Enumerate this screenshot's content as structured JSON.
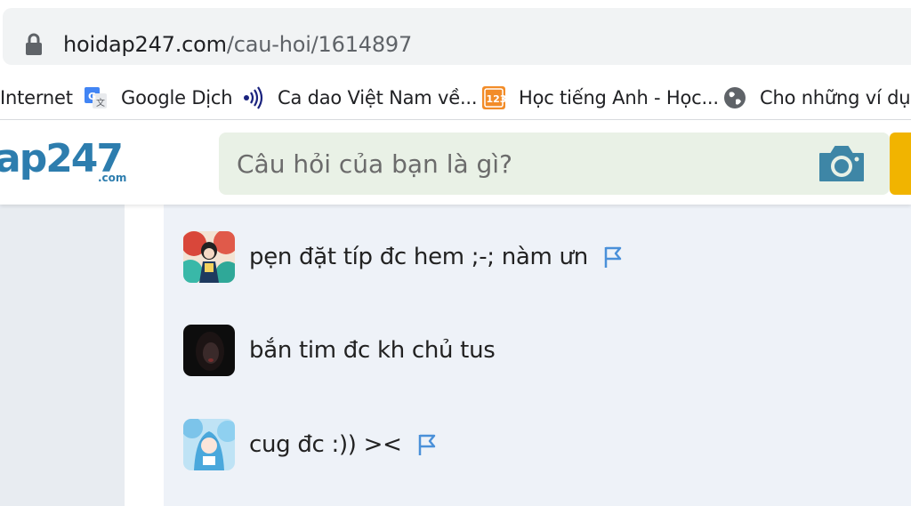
{
  "browser": {
    "url_domain": "hoidap247.com",
    "url_path": "/cau-hoi/1614897",
    "lock_icon": "lock-icon",
    "bookmarks": [
      {
        "label": "Internet",
        "icon": "none"
      },
      {
        "label": "Google Dịch",
        "icon": "google-translate-icon"
      },
      {
        "label": "Ca dao Việt Nam về...",
        "icon": "audio-wave-icon"
      },
      {
        "label": "Học tiếng Anh - Học...",
        "icon": "123-icon"
      },
      {
        "label": "Cho những ví dụ r",
        "icon": "globe-icon"
      }
    ]
  },
  "site": {
    "logo_text": "ap247",
    "logo_sub": ".com",
    "search_placeholder": "Câu hỏi của bạn là gì?",
    "camera_icon": "camera-icon",
    "brand_color": "#2d7dae",
    "accent_color": "#f1b400"
  },
  "comments": [
    {
      "text": "pẹn đặt típ đc hem ;-; nàm ưn",
      "has_flag": true,
      "avatar": "avatar-red-girl"
    },
    {
      "text": "bắn tim đc kh chủ tus",
      "has_flag": false,
      "avatar": "avatar-dark-portrait"
    },
    {
      "text": "cug đc :)) ><",
      "has_flag": true,
      "avatar": "avatar-blue-anime"
    }
  ]
}
